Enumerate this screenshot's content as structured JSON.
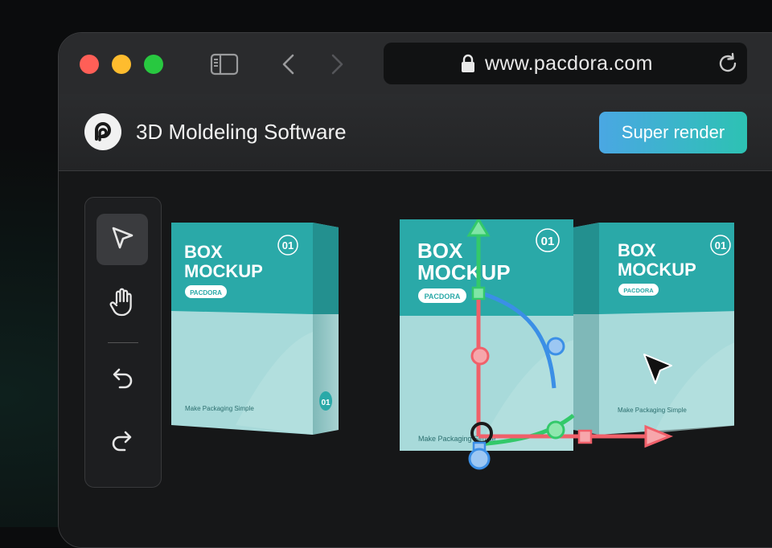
{
  "browser": {
    "url": "www.pacdora.com",
    "traffic_lights": [
      "#ff5f57",
      "#febc2e",
      "#28c840"
    ]
  },
  "app": {
    "title": "3D Moldeling Software",
    "render_button": "Super render",
    "accent_gradient": [
      "#4aa7e3",
      "#2dc2b3"
    ]
  },
  "toolbox": {
    "tools": [
      {
        "name": "select",
        "icon": "pointer-icon",
        "active": true
      },
      {
        "name": "pan",
        "icon": "hand-icon",
        "active": false
      },
      {
        "name": "undo",
        "icon": "undo-icon",
        "active": false
      },
      {
        "name": "redo",
        "icon": "redo-icon",
        "active": false
      }
    ]
  },
  "mockup": {
    "left_box": {
      "title_line1": "BOX",
      "title_line2": "MOCKUP",
      "badge": "PACDORA",
      "number": "01",
      "side_number": "01",
      "tagline": "Make Packaging Simple"
    },
    "center_box": {
      "title_line1": "BOX",
      "title_line2": "MOCKUP",
      "badge": "PACDORA",
      "number": "01",
      "tagline": "Make Packaging Simple"
    },
    "right_box": {
      "title_line1": "BOX",
      "title_line2": "MOCKUP",
      "badge": "PACDORA",
      "number": "01",
      "tagline": "Make Packaging Simple"
    },
    "colors": {
      "teal": "#2aa9a8",
      "light": "#a9dcdc",
      "gizmo_red": "#f0606a",
      "gizmo_green": "#33c96a",
      "gizmo_blue": "#3b8fe6"
    }
  }
}
